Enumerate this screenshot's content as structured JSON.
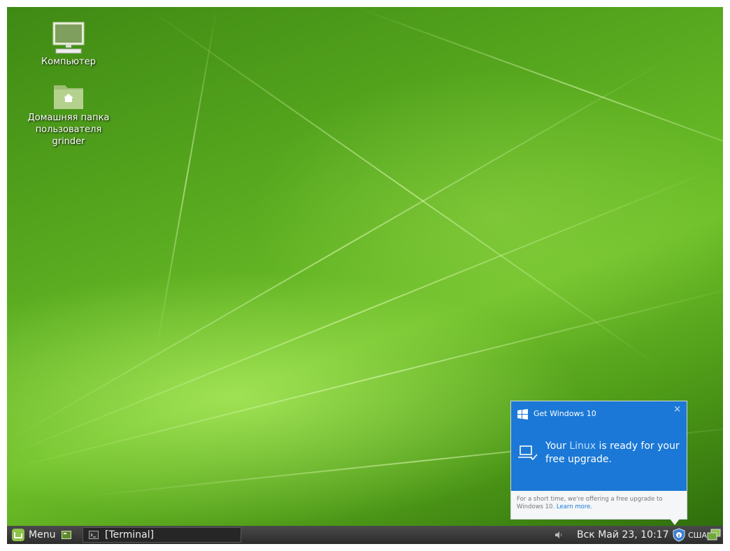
{
  "desktop": {
    "icons": [
      {
        "label": "Компьютер"
      },
      {
        "label": "Домашняя папка пользователя grinder"
      }
    ]
  },
  "popup": {
    "title": "Get Windows 10",
    "close": "×",
    "headline_pre": "Your ",
    "headline_linux": "Linux",
    "headline_post": " is ready for your free upgrade.",
    "body": "For a short time, we're offering a free upgrade to Windows 10.",
    "link": "Learn more."
  },
  "taskbar": {
    "menu_label": "Menu",
    "window_label": "[Terminal]",
    "clock": "Вск Май 23, 10:17",
    "keyboard_layout": "США"
  },
  "colors": {
    "popup_blue": "#1b78d6",
    "taskbar": "#333333"
  }
}
